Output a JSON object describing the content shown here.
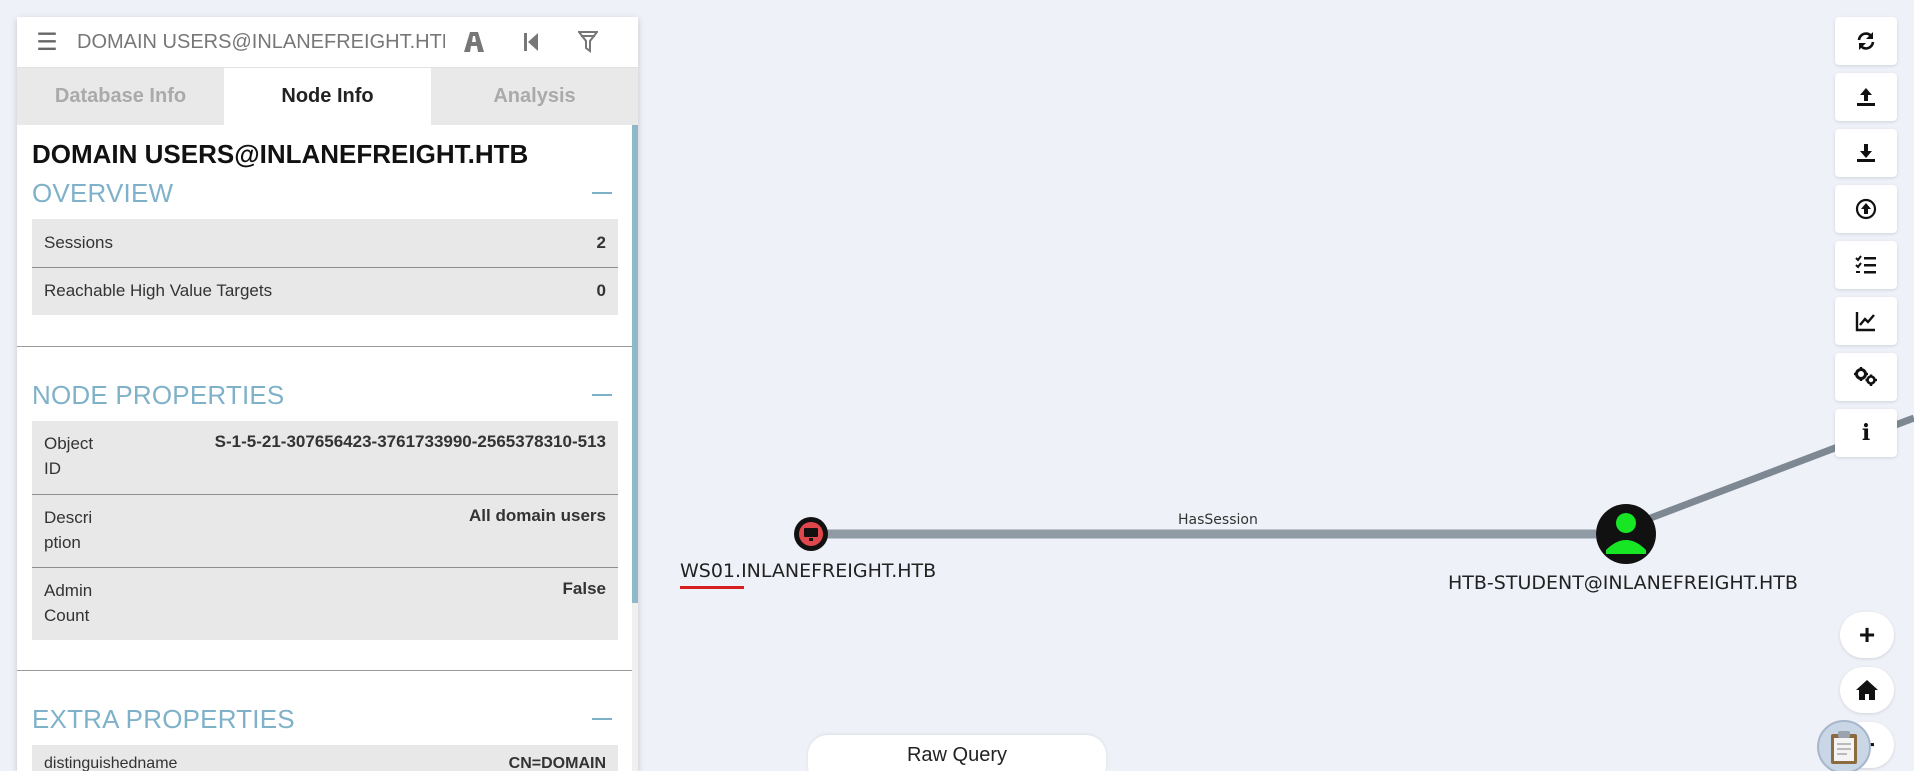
{
  "search": {
    "value": "DOMAIN USERS@INLANEFREIGHT.HTB",
    "menu_icon": "hamburger-menu-icon",
    "pathfinding_icon": "road-icon",
    "back_icon": "step-backward-icon",
    "filter_icon": "filter-icon"
  },
  "tabs": [
    {
      "label": "Database Info",
      "active": false
    },
    {
      "label": "Node Info",
      "active": true
    },
    {
      "label": "Analysis",
      "active": false
    }
  ],
  "node": {
    "title": "DOMAIN USERS@INLANEFREIGHT.HTB",
    "overview": {
      "heading": "OVERVIEW",
      "rows": [
        {
          "key": "Sessions",
          "value": "2"
        },
        {
          "key": "Reachable High Value Targets",
          "value": "0"
        }
      ]
    },
    "properties": {
      "heading": "NODE PROPERTIES",
      "rows": [
        {
          "key": "Object ID",
          "value": "S-1-5-21-307656423-3761733990-2565378310-513"
        },
        {
          "key": "Description",
          "value": "All domain users"
        },
        {
          "key": "Admin Count",
          "value": "False"
        }
      ]
    },
    "extra": {
      "heading": "EXTRA PROPERTIES",
      "rows": [
        {
          "key": "distinguishedname",
          "value": "CN=DOMAIN"
        }
      ]
    }
  },
  "graph": {
    "nodes": [
      {
        "label": "WS01.INLANEFREIGHT.HTB",
        "type": "computer",
        "color": "#e0474c"
      },
      {
        "label": "HTB-STUDENT@INLANEFREIGHT.HTB",
        "type": "user",
        "color": "#17e625"
      }
    ],
    "edges": [
      {
        "label": "HasSession",
        "from": "HTB-STUDENT@INLANEFREIGHT.HTB",
        "to": "WS01.INLANEFREIGHT.HTB"
      }
    ]
  },
  "toolbar": {
    "buttons": [
      "refresh-icon",
      "upload-icon",
      "download-icon",
      "import-icon",
      "queries-list-icon",
      "chart-icon",
      "settings-icon",
      "info-icon"
    ],
    "info_label": "i"
  },
  "zoom": {
    "zoom_in": "+",
    "zoom_out": "−"
  },
  "raw_query": {
    "label": "Raw Query"
  },
  "colors": {
    "accent": "#7fb2c9",
    "background": "#eef1f7",
    "edge": "#8f9aa5"
  }
}
